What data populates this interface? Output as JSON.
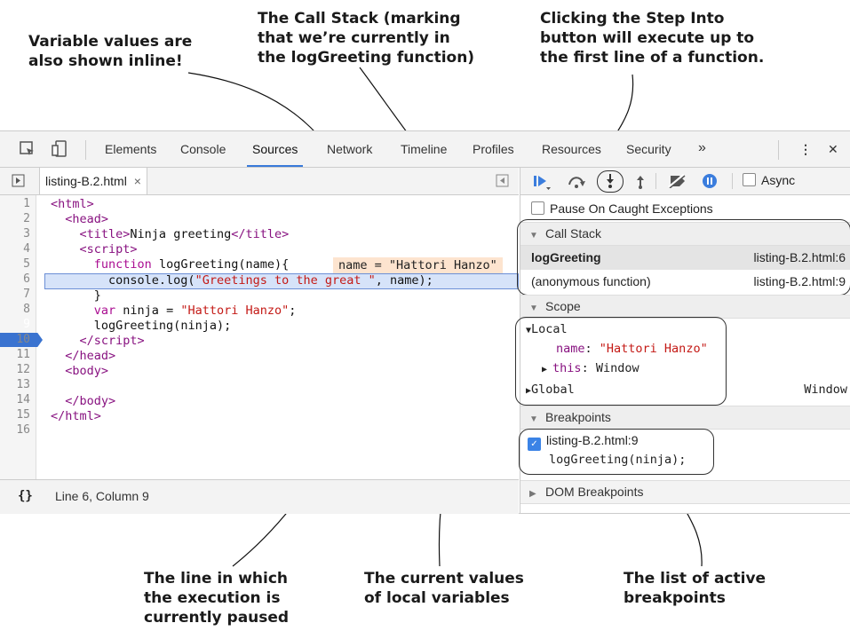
{
  "annotations": {
    "inline_values": "Variable values are\nalso shown inline!",
    "call_stack": "The Call Stack (marking\nthat we’re currently in\nthe logGreeting function)",
    "step_into": "Clicking the Step Into\nbutton will execute up to\nthe first line of a function.",
    "paused_line": "The line in which\nthe execution is\ncurrently paused",
    "local_vars": "The current values\nof local variables",
    "breakpoints_list": "The list of active\nbreakpoints"
  },
  "tabs": [
    "Elements",
    "Console",
    "Sources",
    "Network",
    "Timeline",
    "Profiles",
    "Resources",
    "Security"
  ],
  "active_tab": "Sources",
  "toolbar": {
    "more": "»",
    "menu": "⋮",
    "close": "✕"
  },
  "file_tab": {
    "name": "listing-B.2.html",
    "close": "×"
  },
  "code": {
    "line_numbers": [
      "1",
      "2",
      "3",
      "4",
      "5",
      "6",
      "7",
      "8",
      "9",
      "10",
      "11",
      "12",
      "13",
      "14",
      "15",
      "16"
    ],
    "paused_line": "6",
    "breakpoint_line": "9",
    "inline_value": "name = \"Hattori Hanzo\""
  },
  "status_bar": {
    "braces": "{}",
    "position": "Line 6, Column 9"
  },
  "debugger": {
    "async_label": "Async",
    "pause_on_caught": "Pause On Caught Exceptions",
    "call_stack": {
      "title": "Call Stack",
      "frames": [
        {
          "name": "logGreeting",
          "location": "listing-B.2.html:6"
        },
        {
          "name": "(anonymous function)",
          "location": "listing-B.2.html:9"
        }
      ]
    },
    "scope": {
      "title": "Scope",
      "local_label": "Local",
      "name_key": "name",
      "name_value": "\"Hattori Hanzo\"",
      "this_key": "this",
      "this_value": "Window",
      "global_label": "Global",
      "global_value": "Window"
    },
    "breakpoints": {
      "title": "Breakpoints",
      "file": "listing-B.2.html:9",
      "code": "logGreeting(ninja);"
    },
    "dom_breakpoints": "DOM Breakpoints"
  }
}
